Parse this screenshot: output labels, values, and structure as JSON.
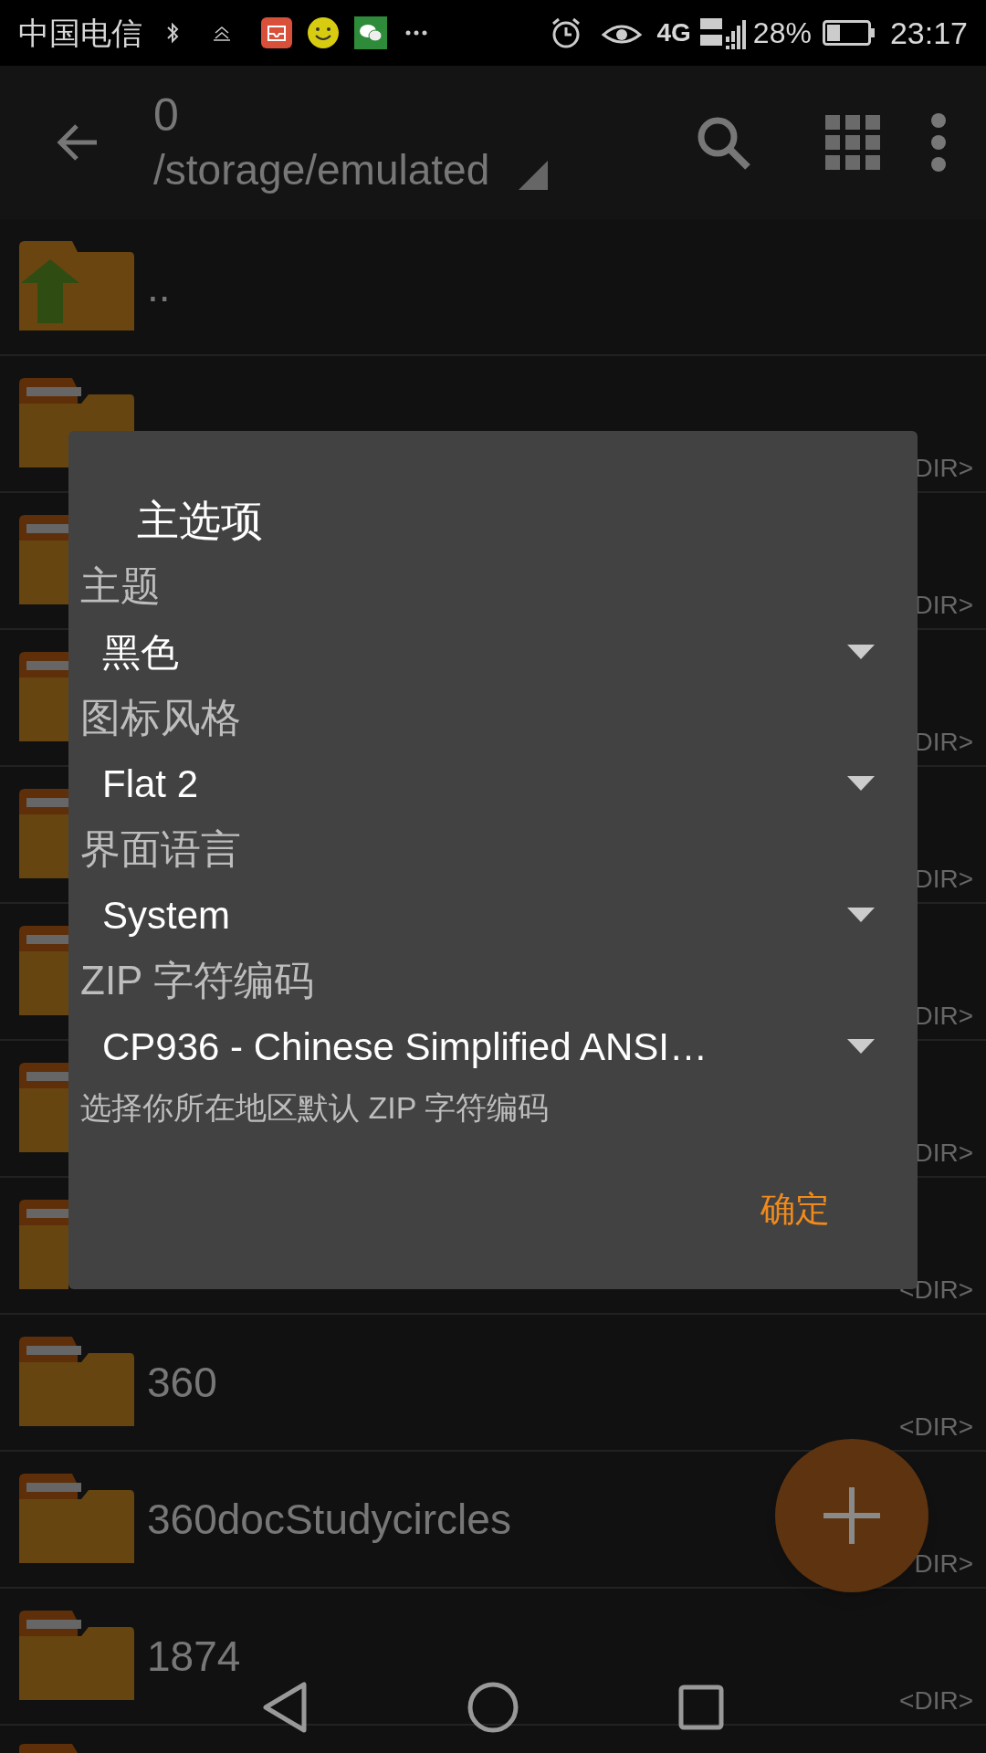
{
  "status_bar": {
    "carrier": "中国电信",
    "battery": "28%",
    "time": "23:17",
    "network": "4G"
  },
  "toolbar": {
    "title": "0",
    "path": "/storage/emulated"
  },
  "files": [
    {
      "kind": "up",
      "name": ".."
    },
    {
      "kind": "folder",
      "info": "DIR>"
    },
    {
      "kind": "edge",
      "info": "DIR>"
    },
    {
      "kind": "edge",
      "info": "DIR>"
    },
    {
      "kind": "edge",
      "info": "DIR>"
    },
    {
      "kind": "edge",
      "info": "DIR>"
    },
    {
      "kind": "edge",
      "info": "DIR>"
    },
    {
      "kind": "edge",
      "info": "<DIR>"
    },
    {
      "kind": "folder",
      "name": "360",
      "info": "<DIR>"
    },
    {
      "kind": "folder",
      "name": "360docStudycircles",
      "info": "DIR>"
    },
    {
      "kind": "folder",
      "name": "1874",
      "info": "<DIR>"
    },
    {
      "kind": "peek"
    }
  ],
  "dialog": {
    "title": "主选项",
    "settings": [
      {
        "label": "主题",
        "value": "黑色"
      },
      {
        "label": "图标风格",
        "value": "Flat 2"
      },
      {
        "label": "界面语言",
        "value": "System"
      },
      {
        "label": "ZIP 字符编码",
        "value": "CP936 - Chinese Simplified ANSI…"
      }
    ],
    "hint": "选择你所在地区默认 ZIP 字符编码",
    "button": "确定"
  }
}
